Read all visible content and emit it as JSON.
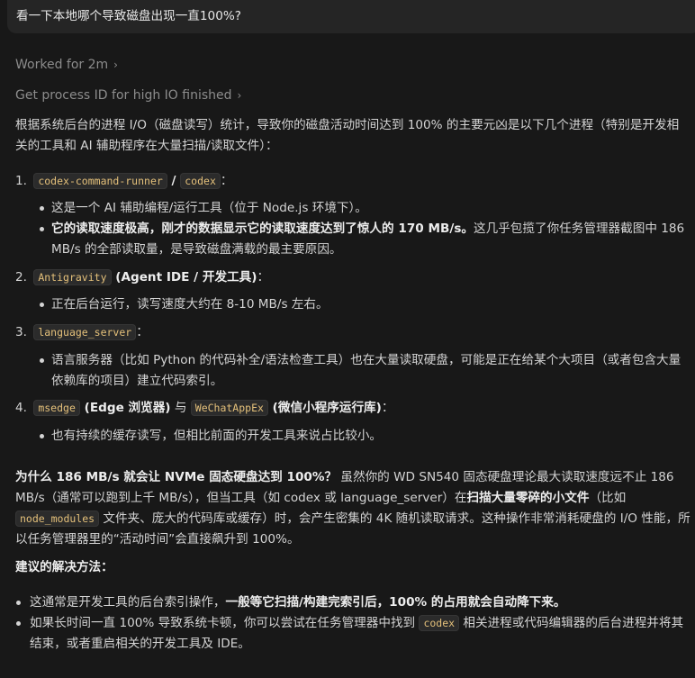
{
  "user_message": "看一下本地哪个导致磁盘出现一直100%?",
  "worked_for": "Worked for 2m",
  "tool_step": "Get process ID for high IO finished",
  "intro": "根据系统后台的进程 I/O（磁盘读写）统计，导致你的磁盘活动时间达到 100% 的主要元凶是以下几个进程（特别是开发相关的工具和 AI 辅助程序在大量扫描/读取文件）：",
  "items": [
    {
      "number": "1.",
      "code1": "codex-command-runner",
      "sep": " / ",
      "code2": "codex",
      "colon": "：",
      "bullet1": "这是一个 AI 辅助编程/运行工具（位于 Node.js 环境下）。",
      "bullet2_bold": "它的读取速度极高，刚才的数据显示它的读取速度达到了惊人的 170 MB/s。",
      "bullet2_rest": "这几乎包揽了你任务管理器截图中 186 MB/s 的全部读取量，是导致磁盘满载的最主要原因。"
    },
    {
      "number": "2.",
      "code": "Antigravity",
      "bold": " (Agent IDE / 开发工具)",
      "colon": "：",
      "bullet": "正在后台运行，读写速度大约在 8-10 MB/s 左右。"
    },
    {
      "number": "3.",
      "code": "language_server",
      "colon": "：",
      "bullet": "语言服务器（比如 Python 的代码补全/语法检查工具）也在大量读取硬盘，可能是正在给某个大项目（或者包含大量依赖库的项目）建立代码索引。"
    },
    {
      "number": "4.",
      "code1": "msedge",
      "bold1": " (Edge 浏览器)",
      "mid": " 与 ",
      "code2": "WeChatAppEx",
      "bold2": " (微信小程序运行库)",
      "colon": "：",
      "bullet": "也有持续的缓存读写，但相比前面的开发工具来说占比较小。"
    }
  ],
  "why": {
    "bold": "为什么 186 MB/s 就会让 NVMe 固态硬盘达到 100%？",
    "text1": " 虽然你的 WD SN540 固态硬盘理论最大读取速度远不止 186 MB/s（通常可以跑到上千 MB/s），但当工具（如 codex 或 language_server）在",
    "bold2": "扫描大量零碎的小文件",
    "text2": "（比如 ",
    "code": "node_modules",
    "text3": " 文件夹、庞大的代码库或缓存）时，会产生密集的 4K 随机读取请求。这种操作非常消耗硬盘的 I/O 性能，所以任务管理器里的“活动时间”会直接飙升到 100%。"
  },
  "advice_heading": "建议的解决方法：",
  "advice": [
    {
      "text": "这通常是开发工具的后台索引操作，",
      "bold": "一般等它扫描/构建完索引后，100% 的占用就会自动降下来。"
    },
    {
      "text1": "如果长时间一直 100% 导致系统卡顿，你可以尝试在任务管理器中找到 ",
      "code": "codex",
      "text2": " 相关进程或代码编辑器的后台进程并将其结束，或者重启相关的开发工具及 IDE。"
    }
  ]
}
